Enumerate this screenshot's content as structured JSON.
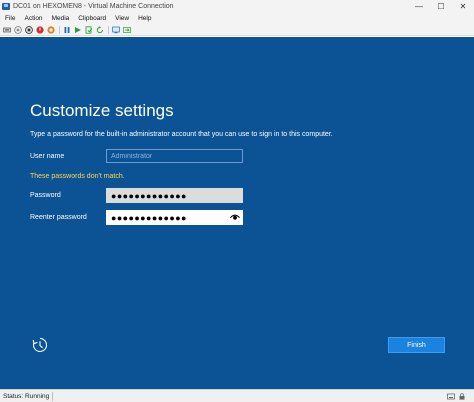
{
  "window": {
    "title": "DC01 on HEXOMEN8 - Virtual Machine Connection",
    "minimize_glyph": "—",
    "maximize_glyph": "☐",
    "close_glyph": "✕"
  },
  "menu": {
    "items": [
      "File",
      "Action",
      "Media",
      "Clipboard",
      "View",
      "Help"
    ]
  },
  "toolbar": {
    "icons": [
      "ctrl-alt-del-icon",
      "start-icon",
      "turn-off-icon",
      "shut-down-icon",
      "save-icon",
      "pause-icon",
      "reset-icon",
      "checkpoint-icon",
      "revert-icon",
      "enhanced-session-icon",
      "share-icon"
    ]
  },
  "vm_screen": {
    "heading": "Customize settings",
    "description": "Type a password for the built-in administrator account that you can use to sign in to this computer.",
    "username_label": "User name",
    "username_placeholder": "Administrator",
    "error_text": "These passwords don't match.",
    "password_label": "Password",
    "password_value": "●●●●●●●●●●●●●",
    "reenter_label": "Reenter password",
    "reenter_value": "●●●●●●●●●●●●●",
    "finish_label": "Finish"
  },
  "status": {
    "text": "Status: Running"
  },
  "colors": {
    "screen_bg": "#0b5394",
    "error": "#ffd84a",
    "button": "#1a83e0"
  }
}
